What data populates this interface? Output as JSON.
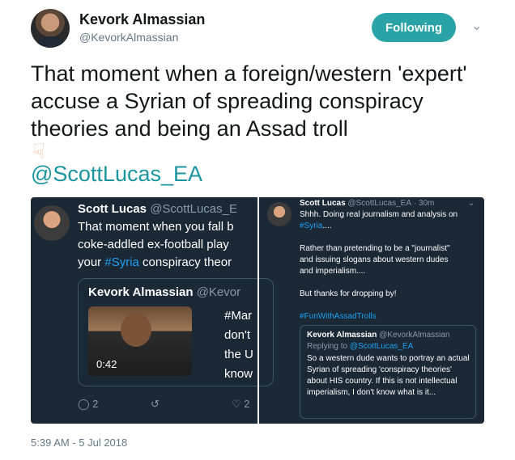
{
  "author": {
    "name": "Kevork Almassian",
    "handle": "@KevorkAlmassian"
  },
  "follow_label": "Following",
  "chevron_icon": "chevron-down-icon",
  "tweet_text": "That moment when a foreign/western 'expert' accuse a Syrian of spreading conspiracy theories and being an Assad troll",
  "emoji_icon": "pointing-down-icon",
  "mention": "@ScottLucas_EA",
  "left_panel": {
    "name": "Scott Lucas",
    "handle": "@ScottLucas_E",
    "line1": "That moment when you fall b",
    "line2": "coke-addled ex-football play",
    "line3_pre": "your ",
    "line3_tag": "#Syria",
    "line3_post": " conspiracy theor",
    "quote_name": "Kevork Almassian",
    "quote_handle": "@Kevor",
    "quote_text": "#Mar\ndon't\nthe U\nknow",
    "video_time": "0:42",
    "reply_count": "2",
    "like_count": "2"
  },
  "right_panel": {
    "name": "Scott Lucas",
    "handle": "@ScottLucas_EA",
    "time": "30m",
    "l1": "Shhh. Doing real journalism and analysis on",
    "l2_tag": "#Syria",
    "l2_post": "....",
    "l3": "Rather than pretending to be a \"journalist\"",
    "l4": "and issuing slogans about western dudes",
    "l5": "and imperialism....",
    "l6": "But thanks for dropping by!",
    "l7_tag": "#FunWithAssadTrolls",
    "quote_name": "Kevork Almassian",
    "quote_handle": "@KevorkAlmassian",
    "reply_prefix": "Replying to ",
    "reply_handle": "@ScottLucas_EA",
    "quote_text": "So a western dude wants to portray an actual Syrian of spreading 'conspiracy theories' about HIS country. If this is not intellectual imperialism, I don't know what is it..."
  },
  "timestamp": "5:39 AM - 5 Jul 2018"
}
